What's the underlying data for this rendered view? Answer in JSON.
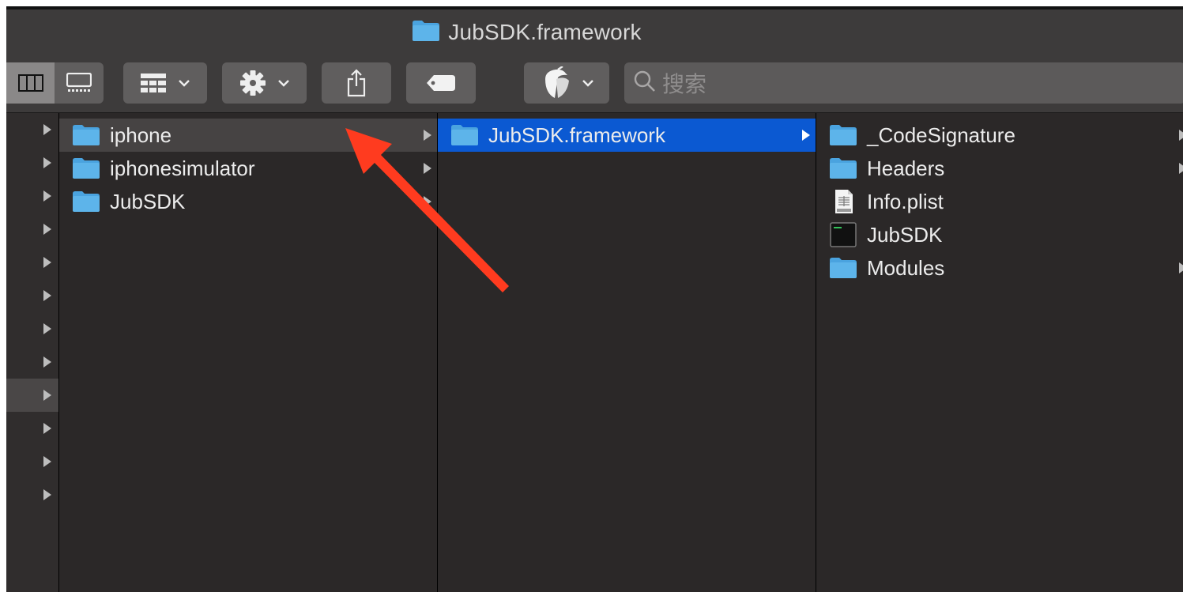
{
  "window": {
    "title": "JubSDK.framework"
  },
  "toolbar": {
    "view_columns_icon": "columns-view-icon",
    "view_gallery_icon": "gallery-view-icon",
    "group_icon": "group-grid-icon",
    "action_icon": "gear-icon",
    "share_icon": "share-icon",
    "tag_icon": "tag-icon",
    "app_icon": "acorn-app-icon",
    "search_placeholder": "搜索"
  },
  "columns": {
    "col1": [
      {
        "name": "iphone",
        "kind": "folder",
        "state": "hover"
      },
      {
        "name": "iphonesimulator",
        "kind": "folder"
      },
      {
        "name": "JubSDK",
        "kind": "folder"
      }
    ],
    "col2": [
      {
        "name": "JubSDK.framework",
        "kind": "folder",
        "state": "selected"
      }
    ],
    "col3": [
      {
        "name": "_CodeSignature",
        "kind": "folder"
      },
      {
        "name": "Headers",
        "kind": "folder"
      },
      {
        "name": "Info.plist",
        "kind": "plist-file"
      },
      {
        "name": "JubSDK",
        "kind": "executable"
      },
      {
        "name": "Modules",
        "kind": "folder"
      }
    ]
  },
  "colors": {
    "selection": "#0b59d2",
    "folder": "#4aa3df",
    "annotation_arrow": "#ff3b1f"
  }
}
